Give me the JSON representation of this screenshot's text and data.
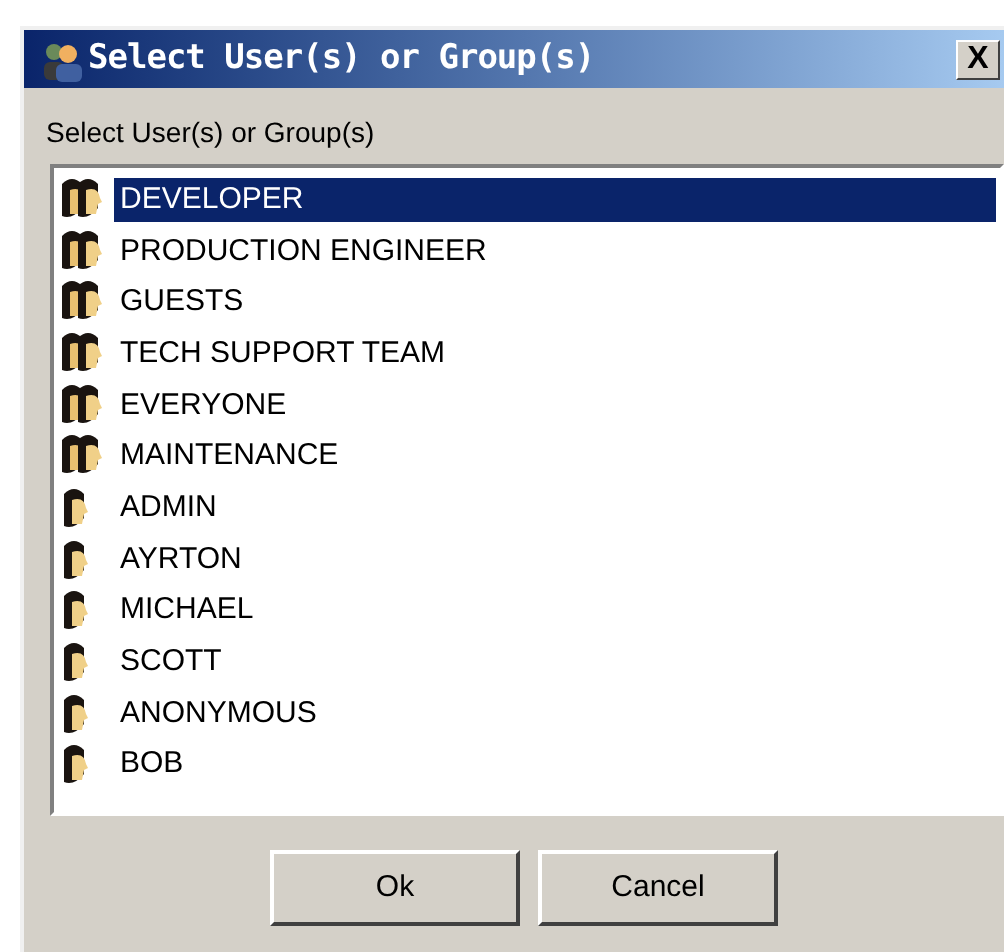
{
  "window": {
    "title": "Select User(s) or Group(s)",
    "close": "X"
  },
  "label": "Select User(s) or Group(s)",
  "list": [
    {
      "name": "DEVELOPER",
      "kind": "group",
      "selected": true
    },
    {
      "name": "PRODUCTION ENGINEER",
      "kind": "group",
      "selected": false
    },
    {
      "name": "GUESTS",
      "kind": "group",
      "selected": false
    },
    {
      "name": "TECH SUPPORT TEAM",
      "kind": "group",
      "selected": false
    },
    {
      "name": "EVERYONE",
      "kind": "group",
      "selected": false
    },
    {
      "name": "MAINTENANCE",
      "kind": "group",
      "selected": false
    },
    {
      "name": "ADMIN",
      "kind": "user",
      "selected": false
    },
    {
      "name": "AYRTON",
      "kind": "user",
      "selected": false
    },
    {
      "name": "MICHAEL",
      "kind": "user",
      "selected": false
    },
    {
      "name": "SCOTT",
      "kind": "user",
      "selected": false
    },
    {
      "name": "ANONYMOUS",
      "kind": "user",
      "selected": false
    },
    {
      "name": "BOB",
      "kind": "user",
      "selected": false
    }
  ],
  "buttons": [
    "Ok",
    "Cancel"
  ]
}
